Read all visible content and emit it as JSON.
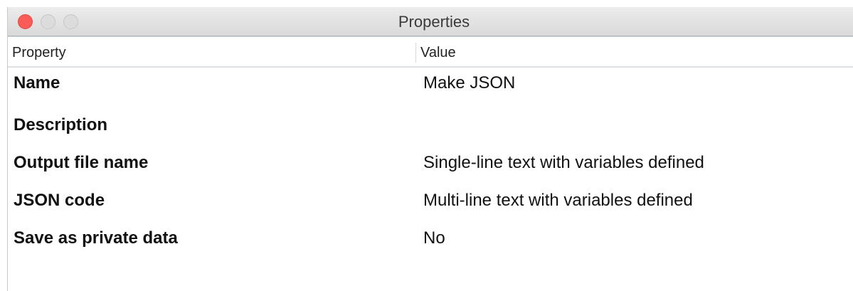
{
  "window": {
    "title": "Properties"
  },
  "table": {
    "columns": {
      "property": "Property",
      "value": "Value"
    },
    "rows": [
      {
        "property": "Name",
        "value": "Make JSON"
      },
      {
        "property": "Description",
        "value": ""
      },
      {
        "property": "Output file name",
        "value": "Single-line text with variables defined"
      },
      {
        "property": "JSON code",
        "value": "Multi-line text with variables defined"
      },
      {
        "property": "Save as private data",
        "value": "No"
      }
    ]
  }
}
